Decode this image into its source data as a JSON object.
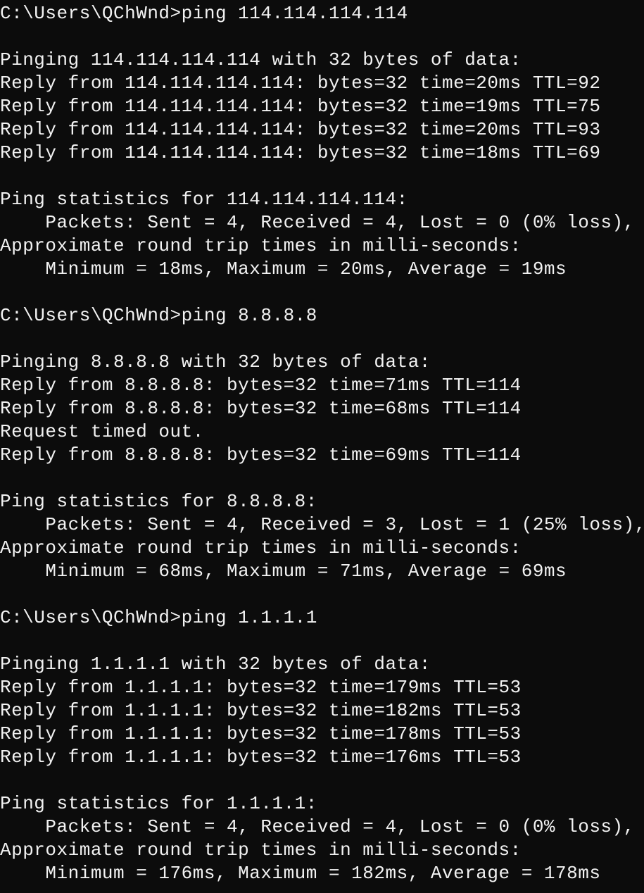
{
  "terminal": {
    "colors": {
      "background": "#0c0c0c",
      "foreground": "#f2f2f2"
    },
    "lines": [
      "C:\\Users\\QChWnd>ping 114.114.114.114",
      "",
      "Pinging 114.114.114.114 with 32 bytes of data:",
      "Reply from 114.114.114.114: bytes=32 time=20ms TTL=92",
      "Reply from 114.114.114.114: bytes=32 time=19ms TTL=75",
      "Reply from 114.114.114.114: bytes=32 time=20ms TTL=93",
      "Reply from 114.114.114.114: bytes=32 time=18ms TTL=69",
      "",
      "Ping statistics for 114.114.114.114:",
      "    Packets: Sent = 4, Received = 4, Lost = 0 (0% loss),",
      "Approximate round trip times in milli-seconds:",
      "    Minimum = 18ms, Maximum = 20ms, Average = 19ms",
      "",
      "C:\\Users\\QChWnd>ping 8.8.8.8",
      "",
      "Pinging 8.8.8.8 with 32 bytes of data:",
      "Reply from 8.8.8.8: bytes=32 time=71ms TTL=114",
      "Reply from 8.8.8.8: bytes=32 time=68ms TTL=114",
      "Request timed out.",
      "Reply from 8.8.8.8: bytes=32 time=69ms TTL=114",
      "",
      "Ping statistics for 8.8.8.8:",
      "    Packets: Sent = 4, Received = 3, Lost = 1 (25% loss),",
      "Approximate round trip times in milli-seconds:",
      "    Minimum = 68ms, Maximum = 71ms, Average = 69ms",
      "",
      "C:\\Users\\QChWnd>ping 1.1.1.1",
      "",
      "Pinging 1.1.1.1 with 32 bytes of data:",
      "Reply from 1.1.1.1: bytes=32 time=179ms TTL=53",
      "Reply from 1.1.1.1: bytes=32 time=182ms TTL=53",
      "Reply from 1.1.1.1: bytes=32 time=178ms TTL=53",
      "Reply from 1.1.1.1: bytes=32 time=176ms TTL=53",
      "",
      "Ping statistics for 1.1.1.1:",
      "    Packets: Sent = 4, Received = 4, Lost = 0 (0% loss),",
      "Approximate round trip times in milli-seconds:",
      "    Minimum = 176ms, Maximum = 182ms, Average = 178ms"
    ]
  }
}
